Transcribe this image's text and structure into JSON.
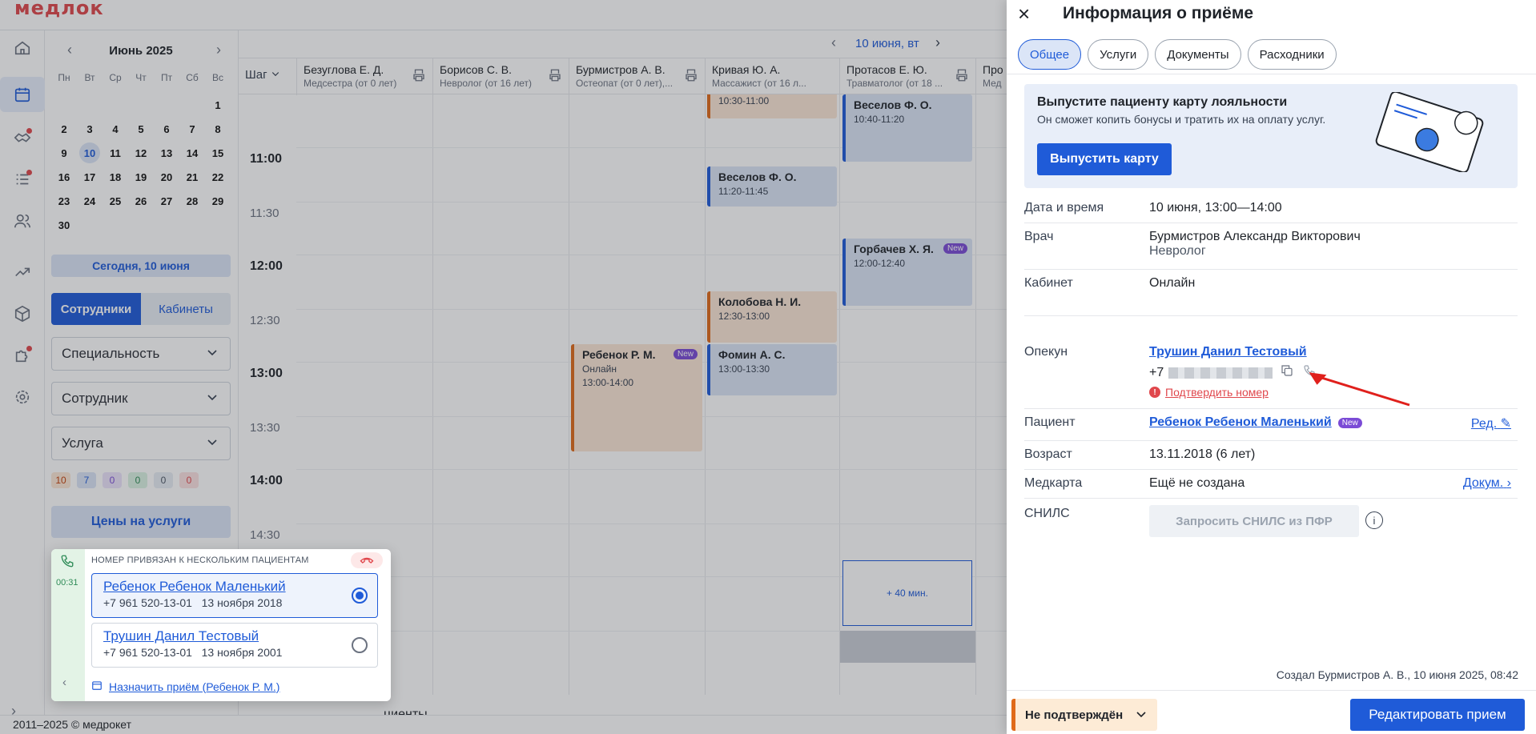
{
  "app": {
    "logo": "медлок",
    "footer": "2011–2025 © медрокет"
  },
  "calendar": {
    "month": "Июнь 2025",
    "dow": [
      "Пн",
      "Вт",
      "Ср",
      "Чт",
      "Пт",
      "Сб",
      "Вс"
    ],
    "weeks": [
      [
        "",
        "",
        "",
        "",
        "",
        "",
        "1"
      ],
      [
        "2",
        "3",
        "4",
        "5",
        "6",
        "7",
        "8"
      ],
      [
        "9",
        "10",
        "11",
        "12",
        "13",
        "14",
        "15"
      ],
      [
        "16",
        "17",
        "18",
        "19",
        "20",
        "21",
        "22"
      ],
      [
        "23",
        "24",
        "25",
        "26",
        "27",
        "28",
        "29"
      ],
      [
        "30",
        "",
        "",
        "",
        "",
        "",
        ""
      ]
    ],
    "selected": "10",
    "today": "Сегодня, 10 июня"
  },
  "segment": {
    "staff": "Сотрудники",
    "rooms": "Кабинеты"
  },
  "filters": {
    "specialty": "Специальность",
    "employee": "Сотрудник",
    "service": "Услуга"
  },
  "counters": [
    {
      "v": "10",
      "c": "#fde8d6",
      "t": "#c2410c"
    },
    {
      "v": "7",
      "c": "#dbe5f7",
      "t": "#1f5bd8"
    },
    {
      "v": "0",
      "c": "#ece4fb",
      "t": "#7b4bd6"
    },
    {
      "v": "0",
      "c": "#dcf3e3",
      "t": "#2e8b57"
    },
    {
      "v": "0",
      "c": "#e8edf4",
      "t": "#4b5563"
    },
    {
      "v": "0",
      "c": "#fde2e2",
      "t": "#e0474c"
    }
  ],
  "prices": "Цены на услуги",
  "schedule": {
    "date": "10 июня, вт",
    "step": "Шаг",
    "columns": [
      {
        "name": "Безуглова Е. Д.",
        "spec": "Медсестра (от 0 лет)"
      },
      {
        "name": "Борисов С. В.",
        "spec": "Невролог (от 16 лет)"
      },
      {
        "name": "Бурмистров А. В.",
        "spec": "Остеопат (от 0 лет),..."
      },
      {
        "name": "Кривая Ю. А.",
        "spec": "Массажист (от 16 л..."
      },
      {
        "name": "Протасов Е. Ю.",
        "spec": "Травматолог (от 18 ..."
      },
      {
        "name": "Про",
        "spec": "Мед"
      }
    ],
    "times": [
      "11:00",
      "11:30",
      "12:00",
      "12:30",
      "13:00",
      "13:30",
      "14:00",
      "14:30"
    ],
    "events": {
      "e1": {
        "time": "10:30-11:00"
      },
      "e2": {
        "name": "Веселов Ф. О.",
        "time": "10:40-11:20"
      },
      "e3": {
        "name": "Веселов Ф. О.",
        "time": "11:20-11:45"
      },
      "e4": {
        "name": "Горбачев Х. Я.",
        "time": "12:00-12:40",
        "badge": "New"
      },
      "e5": {
        "name": "Колобова Н. И.",
        "time": "12:30-13:00"
      },
      "e6": {
        "name": "Ребенок Р. М.",
        "room": "Онлайн",
        "time": "13:00-14:00",
        "badge": "New"
      },
      "e7": {
        "name": "Фомин А. С.",
        "time": "13:00-13:30"
      }
    },
    "plus": "+ 40 мин.",
    "behind_text": "циенты"
  },
  "call": {
    "header": "НОМЕР ПРИВЯЗАН К НЕСКОЛЬКИМ ПАЦИЕНТАМ",
    "timer": "00:31",
    "patients": [
      {
        "name": "Ребенок Ребенок Маленький",
        "phone": "+7 961 520-13-01",
        "dob": "13 ноября 2018"
      },
      {
        "name": "Трушин Данил Тестовый",
        "phone": "+7 961 520-13-01",
        "dob": "13 ноября 2001"
      }
    ],
    "assign": "Назначить приём (Ребенок Р. М.)"
  },
  "drawer": {
    "title": "Информация о приёме",
    "tabs": [
      "Общее",
      "Услуги",
      "Документы",
      "Расходники"
    ],
    "loyalty": {
      "title": "Выпустите пациенту карту лояльности",
      "subtitle": "Он сможет копить бонусы и тратить их на оплату услуг.",
      "button": "Выпустить карту"
    },
    "fields": {
      "date": {
        "label": "Дата и время",
        "value": "10 июня, 13:00—14:00"
      },
      "doctor": {
        "label": "Врач",
        "value": "Бурмистров Александр Викторович",
        "sub": "Невролог"
      },
      "room": {
        "label": "Кабинет",
        "value": "Онлайн"
      },
      "guardian": {
        "label": "Опекун",
        "value": "Трушин Данил Тестовый",
        "phone_prefix": "+7",
        "warn": "Подтвердить номер"
      },
      "patient": {
        "label": "Пациент",
        "value": "Ребенок Ребенок Маленький",
        "badge": "New",
        "edit": "Ред."
      },
      "age": {
        "label": "Возраст",
        "value": "13.11.2018 (6 лет)"
      },
      "card": {
        "label": "Медкарта",
        "value": "Ещё не создана",
        "link": "Докум."
      },
      "snils": {
        "label": "СНИЛС",
        "button": "Запросить СНИЛС из ПФР"
      }
    },
    "created": "Создал Бурмистров А. В., 10 июня 2025, 08:42",
    "status": "Не подтверждён",
    "edit_button": "Редактировать прием"
  }
}
